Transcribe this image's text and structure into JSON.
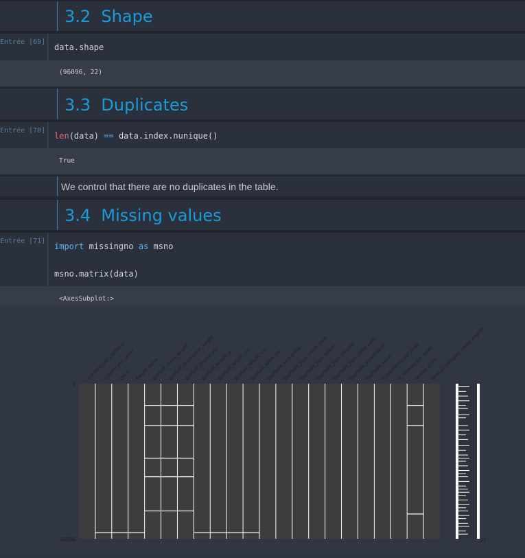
{
  "sections": {
    "shape": {
      "title": "3.2  Shape"
    },
    "duplicates": {
      "title": "3.3  Duplicates"
    },
    "missing": {
      "title": "3.4  Missing values"
    }
  },
  "cells": {
    "c69": {
      "prompt": "Entrée [69]:",
      "code": "data.shape",
      "output": "(96096, 22)"
    },
    "c70": {
      "prompt": "Entrée [70]:",
      "code_fn": "len",
      "code_a": "(data) ",
      "code_op": "==",
      "code_b": " data.index.nunique()",
      "output": "True"
    },
    "note": {
      "text": "We control that there are no duplicates in the table."
    },
    "c71": {
      "prompt": "Entrée [71]:",
      "kw_import": "import",
      "mod": " missingno ",
      "kw_as": "as",
      "alias": " msno",
      "line2": "msno.matrix(data)",
      "output": "<AxesSubplot:>"
    }
  },
  "colors": {
    "heading": "#1a9bd7",
    "cell_bg": "#2b313c",
    "output_bg": "#363c48",
    "matrix_fill": "#3d3d3d",
    "matrix_line": "#ffffff"
  },
  "chart_data": {
    "type": "heatmap",
    "kind": "missingno matrix",
    "columns": [
      "n_orders_per_customer",
      "n_items_per_order",
      "price",
      "freight_value",
      "product_name_lenght",
      "product_description_lenght",
      "product_photos_qty",
      "product_weight_g",
      "product_length_cm",
      "product_height_cm",
      "product_width_cm",
      "payment_sequential",
      "payment_type_credit_card",
      "payment_type_boleto",
      "payment_type_voucher",
      "payment_type_debit_card",
      "payment_installments",
      "payment_value",
      "n_payments_per_order",
      "n_reviews_per_order",
      "review_score",
      "product_category_name_english"
    ],
    "row_range": [
      1,
      96096
    ],
    "ytick_labels": [
      "1",
      "96096"
    ],
    "sparkline_labels": [
      "",
      "22"
    ],
    "missing_rows": {
      "product_name_lenght": [
        0.14,
        0.27,
        0.48,
        0.6,
        0.82
      ],
      "product_description_lenght": [
        0.14,
        0.27,
        0.48,
        0.6,
        0.82
      ],
      "product_photos_qty": [
        0.14,
        0.27,
        0.48,
        0.6,
        0.82
      ],
      "review_score": [
        0.14,
        0.27,
        0.84
      ],
      "n_items_per_order": [
        0.96
      ],
      "price": [
        0.96
      ],
      "freight_value": [
        0.96
      ],
      "product_weight_g": [
        0.96
      ],
      "product_length_cm": [
        0.96
      ],
      "product_height_cm": [
        0.96
      ],
      "product_width_cm": [
        0.96
      ]
    }
  }
}
